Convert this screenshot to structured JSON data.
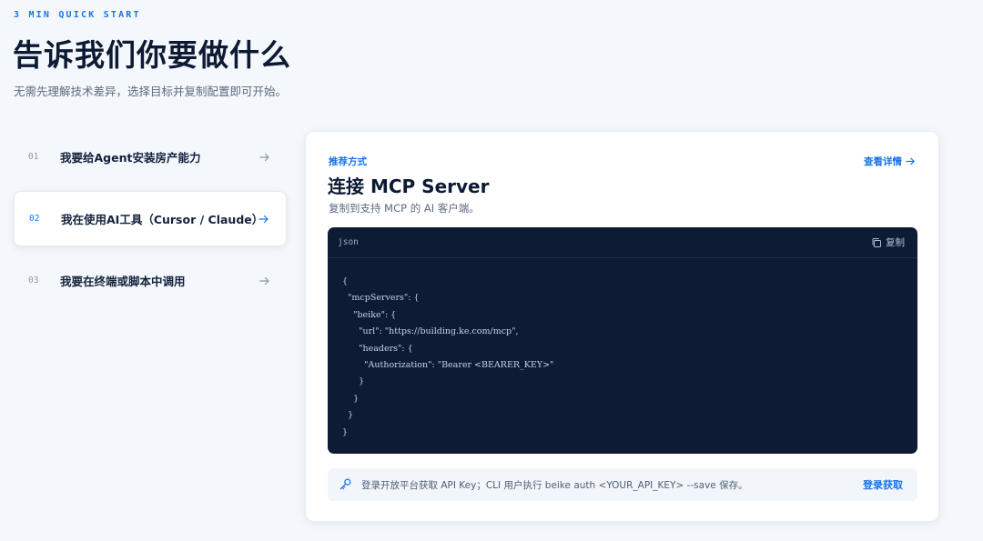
{
  "hero": {
    "eyebrow": "3 MIN QUICK START",
    "title": "告诉我们你要做什么",
    "subtitle": "无需先理解技术差异，选择目标并复制配置即可开始。"
  },
  "steps": [
    {
      "num": "01",
      "label": "我要给Agent安装房产能力",
      "active": false
    },
    {
      "num": "02",
      "label": "我在使用AI工具（Cursor / Claude）",
      "active": true
    },
    {
      "num": "03",
      "label": "我要在终端或脚本中调用",
      "active": false
    }
  ],
  "card": {
    "eyebrow": "推荐方式",
    "details_label": "查看详情",
    "title": "连接 MCP Server",
    "subtitle": "复制到支持 MCP 的 AI 客户端。",
    "code": {
      "lang": "json",
      "copy_label": "复制",
      "content": "{\n  \"mcpServers\": {\n    \"beike\": {\n      \"url\": \"https://building.ke.com/mcp\",\n      \"headers\": {\n        \"Authorization\": \"Bearer <BEARER_KEY>\"\n      }\n    }\n  }\n}"
    },
    "notice": {
      "text": "登录开放平台获取 API Key；CLI 用户执行 beike auth <YOUR_API_KEY> --save 保存。",
      "action_label": "登录获取"
    }
  },
  "colors": {
    "accent": "#1a73e8",
    "code_bg": "#0d1b34",
    "page_bg": "#f4f7fb"
  }
}
